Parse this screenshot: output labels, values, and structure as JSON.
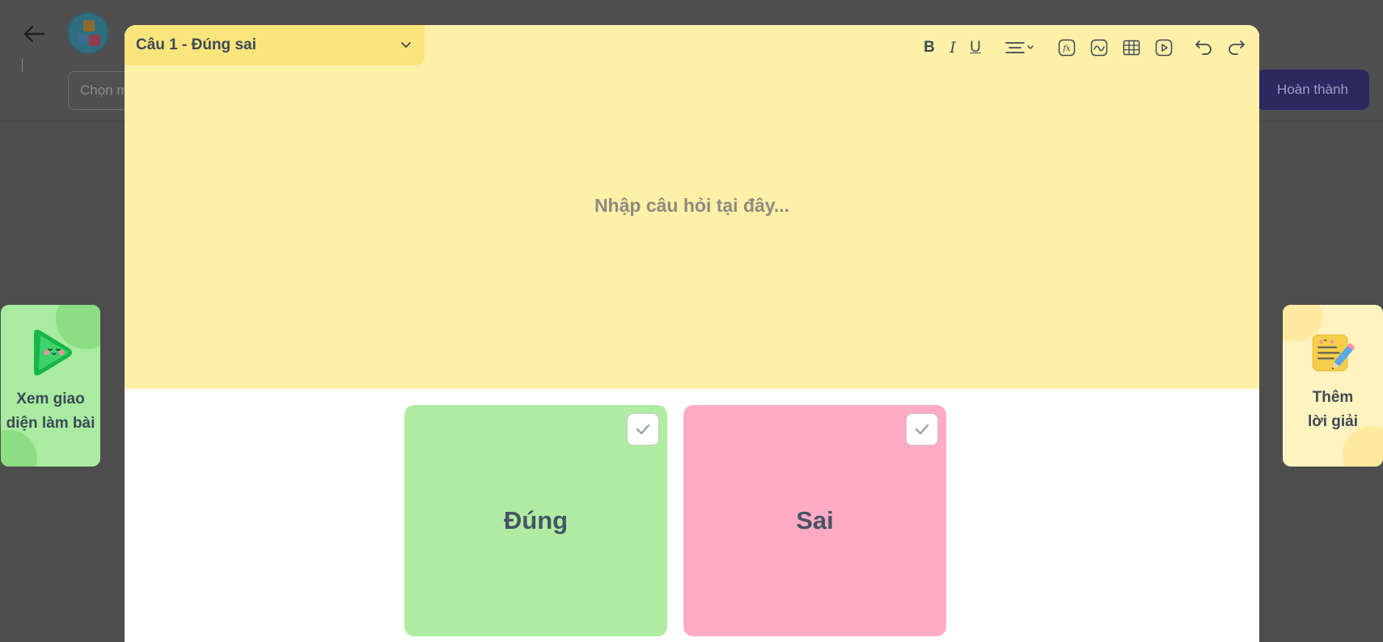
{
  "header": {
    "select_placeholder": "Chọn m",
    "finish_label": "Hoàn thành"
  },
  "side": {
    "preview_label": "Xem giao diện làm bài",
    "solution_label": "Thêm lời giải"
  },
  "question": {
    "type_label": "Câu 1 - Đúng sai",
    "placeholder": "Nhập câu hỏi tại đây..."
  },
  "toolbar": {
    "bold": "B",
    "italic": "I",
    "underline": "U"
  },
  "answers": [
    {
      "label": "Đúng",
      "color": "#b0eca2"
    },
    {
      "label": "Sai",
      "color": "#ffabc5"
    }
  ],
  "colors": {
    "overlay": "#4d4d4d",
    "editor_bg": "#fff0a8",
    "type_bg": "#fae57c",
    "finish_btn": "#2d2860",
    "text_dark": "#3c4a57"
  },
  "icons": [
    "back-arrow-icon",
    "chevron-down-icon",
    "align-icon",
    "formula-icon",
    "graph-icon",
    "table-icon",
    "video-icon",
    "undo-icon",
    "redo-icon",
    "check-icon",
    "play-icon",
    "note-pencil-icon"
  ]
}
